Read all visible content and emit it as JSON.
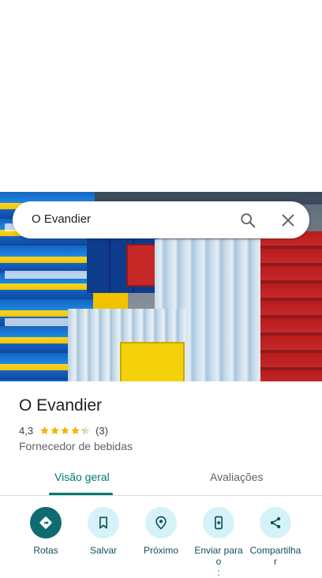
{
  "search": {
    "query": "O Evandier"
  },
  "place": {
    "name": "O Evandier",
    "rating": "4,3",
    "rating_stars": 4.3,
    "review_count": "(3)",
    "category": "Fornecedor de bebidas"
  },
  "tabs": [
    {
      "label": "Visão geral",
      "active": true
    },
    {
      "label": "Avaliações",
      "active": false
    }
  ],
  "actions": [
    {
      "label": "Rotas",
      "icon": "directions-icon"
    },
    {
      "label": "Salvar",
      "icon": "bookmark-icon"
    },
    {
      "label": "Próximo",
      "icon": "nearby-icon"
    },
    {
      "label": "Enviar para\no\n:",
      "icon": "send-to-phone-icon"
    },
    {
      "label": "Compartilha\nr",
      "icon": "share-icon"
    }
  ],
  "colors": {
    "accent": "#00796b",
    "action_primary": "#0f6b6f",
    "action_secondary": "#d6f2f9",
    "star": "#f4b400"
  }
}
